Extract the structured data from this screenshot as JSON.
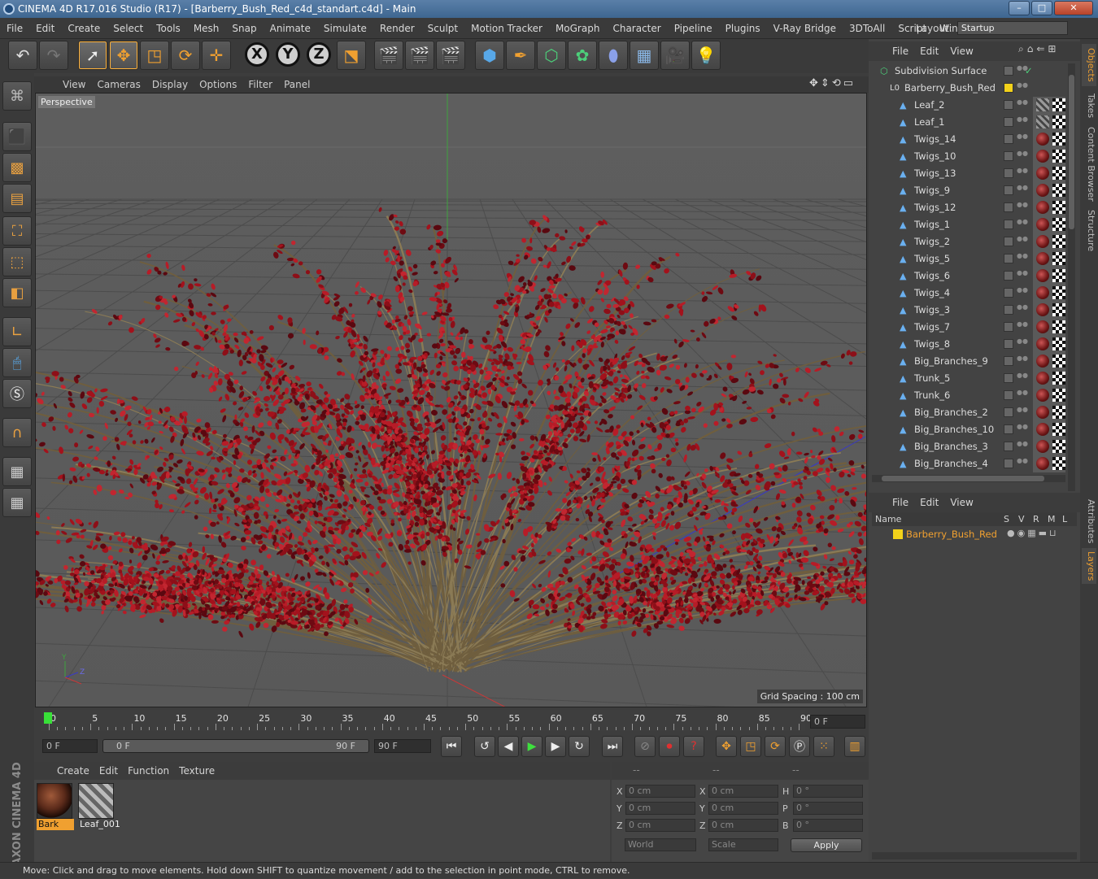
{
  "window": {
    "title": "CINEMA 4D R17.016 Studio (R17) - [Barberry_Bush_Red_c4d_standart.c4d] - Main",
    "minimize": "–",
    "maximize": "□",
    "close": "✕"
  },
  "menubar": {
    "items": [
      "File",
      "Edit",
      "Create",
      "Select",
      "Tools",
      "Mesh",
      "Snap",
      "Animate",
      "Simulate",
      "Render",
      "Sculpt",
      "Motion Tracker",
      "MoGraph",
      "Character",
      "Pipeline",
      "Plugins",
      "V-Ray Bridge",
      "3DToAll",
      "Script",
      "Window"
    ],
    "layout_label": "Layout:",
    "layout_value": "Startup"
  },
  "toolbar": {
    "axis_x": "X",
    "axis_y": "Y",
    "axis_z": "Z"
  },
  "viewport": {
    "menu": [
      "View",
      "Cameras",
      "Display",
      "Options",
      "Filter",
      "Panel"
    ],
    "camera_label": "Perspective",
    "grid_spacing": "Grid Spacing : 100 cm",
    "axis_y": "Y",
    "axis_z": "Z"
  },
  "timeline": {
    "ticks": [
      "0",
      "5",
      "10",
      "15",
      "20",
      "25",
      "30",
      "35",
      "40",
      "45",
      "50",
      "55",
      "60",
      "65",
      "70",
      "75",
      "80",
      "85",
      "90"
    ],
    "current_frame": "0 F",
    "start_frame": "0 F",
    "range_start": "0 F",
    "range_end": "90 F",
    "end_frame": "90 F"
  },
  "materials": {
    "menu": [
      "Create",
      "Edit",
      "Function",
      "Texture"
    ],
    "items": [
      {
        "name": "Bark"
      },
      {
        "name": "Leaf_001"
      }
    ]
  },
  "coordinates": {
    "header": [
      "--",
      "--",
      "--"
    ],
    "rows": [
      {
        "pos_label": "X",
        "pos": "0 cm",
        "size_label": "X",
        "size": "0 cm",
        "rot_label": "H",
        "rot": "0 °"
      },
      {
        "pos_label": "Y",
        "pos": "0 cm",
        "size_label": "Y",
        "size": "0 cm",
        "rot_label": "P",
        "rot": "0 °"
      },
      {
        "pos_label": "Z",
        "pos": "0 cm",
        "size_label": "Z",
        "size": "0 cm",
        "rot_label": "B",
        "rot": "0 °"
      }
    ],
    "space": "World",
    "mode": "Scale",
    "apply": "Apply"
  },
  "objects": {
    "menu": [
      "File",
      "Edit",
      "View"
    ],
    "root": "Subdivision Surface",
    "group": "Barberry_Bush_Red",
    "children": [
      "Leaf_2",
      "Leaf_1",
      "Twigs_14",
      "Twigs_10",
      "Twigs_13",
      "Twigs_9",
      "Twigs_12",
      "Twigs_1",
      "Twigs_2",
      "Twigs_5",
      "Twigs_6",
      "Twigs_4",
      "Twigs_3",
      "Twigs_7",
      "Twigs_8",
      "Big_Branches_9",
      "Trunk_5",
      "Trunk_6",
      "Big_Branches_2",
      "Big_Branches_10",
      "Big_Branches_3",
      "Big_Branches_4"
    ]
  },
  "layers": {
    "menu": [
      "File",
      "Edit",
      "View"
    ],
    "columns": {
      "name": "Name",
      "s": "S",
      "v": "V",
      "r": "R",
      "m": "M",
      "l": "L"
    },
    "items": [
      "Barberry_Bush_Red"
    ]
  },
  "side_tabs": {
    "top": [
      "Objects",
      "Takes",
      "Content Browser",
      "Structure"
    ],
    "bottom": [
      "Attributes",
      "Layers"
    ]
  },
  "logo": "MAXON CINEMA 4D",
  "status": "Move: Click and drag to move elements. Hold down SHIFT to quantize movement / add to the selection in point mode, CTRL to remove.",
  "colors": {
    "accent": "#f0a030",
    "bush": "#a3121c",
    "layer_yellow": "#f3d21a"
  }
}
